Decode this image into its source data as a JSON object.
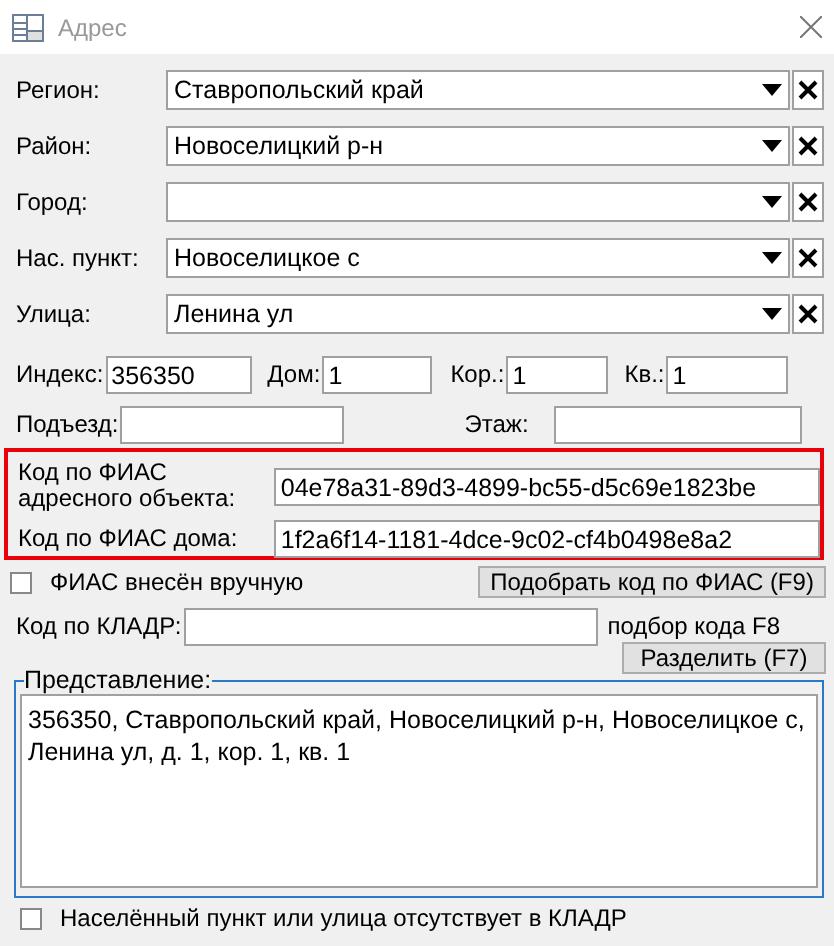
{
  "window": {
    "title": "Адрес"
  },
  "combos": [
    {
      "label": "Регион:",
      "value": "Ставропольский край"
    },
    {
      "label": "Район:",
      "value": "Новоселицкий р-н"
    },
    {
      "label": "Город:"
    },
    {
      "label": "Нас. пункт:",
      "value": "Новоселицкое с"
    },
    {
      "label": "Улица:",
      "value": "Ленина ул"
    }
  ],
  "number_fields": [
    {
      "label": "Индекс:",
      "value": "356350"
    },
    {
      "label": "Дом:",
      "value": "1"
    },
    {
      "label": "Кор.:",
      "value": "1"
    },
    {
      "label": "Кв.:",
      "value": "1"
    }
  ],
  "entrance": {
    "label": "Подъезд:"
  },
  "floor": {
    "label": "Этаж:"
  },
  "fias": {
    "object_label": "Код по ФИАС адресного объекта:",
    "object_value": "04e78a31-89d3-4899-bc55-d5c69e1823be",
    "house_label": "Код по ФИАС дома:",
    "house_value": "1f2a6f14-1181-4dce-9c02-cf4b0498e8a2"
  },
  "fias_manual": {
    "label": "ФИАС внесён вручную",
    "checked": false
  },
  "fias_button": "Подобрать код по ФИАС (F9)",
  "kladr": {
    "label": "Код по КЛАДР:",
    "hint": "подбор кода F8"
  },
  "split_button": "Разделить (F7)",
  "presentation": {
    "legend": "Представление:",
    "text": "356350, Ставропольский край, Новоселицкий р-н, Новоселицкое с, Ленина ул, д. 1, кор. 1, кв. 1"
  },
  "missing_kladr": {
    "label": "Населённый пункт или улица отсутствует в КЛАДР",
    "checked": false
  }
}
